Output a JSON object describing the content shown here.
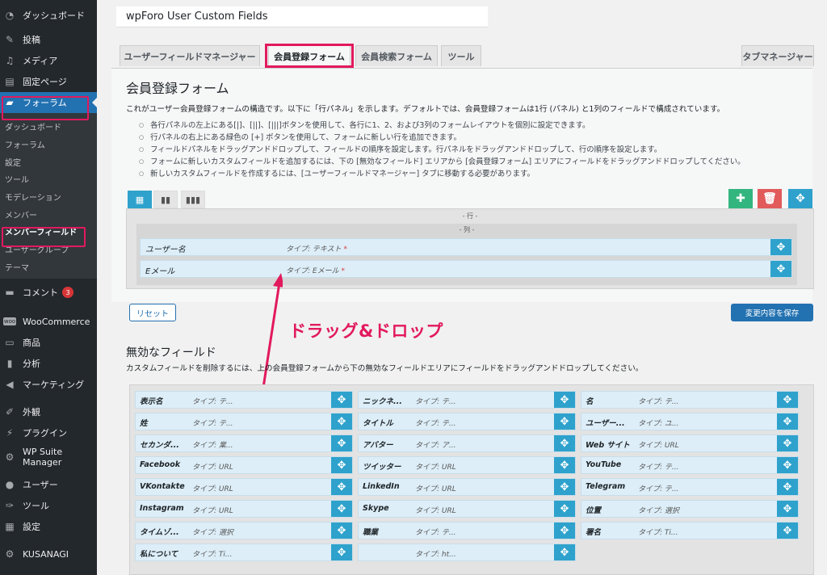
{
  "sidebar": {
    "top_items": [
      {
        "label": "ダッシュボード",
        "icon": "dashboard-icon"
      },
      {
        "label": "投稿",
        "icon": "pin-icon"
      },
      {
        "label": "メディア",
        "icon": "media-icon"
      },
      {
        "label": "固定ページ",
        "icon": "page-icon"
      }
    ],
    "forum": {
      "label": "フォーラム",
      "icon": "forum-icon"
    },
    "sub_items": [
      "ダッシュボード",
      "フォーラム",
      "設定",
      "ツール",
      "モデレーション",
      "メンバー",
      "メンバーフィールド",
      "ユーザーグループ",
      "テーマ"
    ],
    "comments": {
      "label": "コメント",
      "badge": "3"
    },
    "bottom_items": [
      {
        "label": "WooCommerce",
        "icon": "woo-icon"
      },
      {
        "label": "商品",
        "icon": "archive-icon"
      },
      {
        "label": "分析",
        "icon": "chart-icon"
      },
      {
        "label": "マーケティング",
        "icon": "megaphone-icon"
      },
      {
        "label": "外観",
        "icon": "brush-icon"
      },
      {
        "label": "プラグイン",
        "icon": "plugin-icon"
      }
    ],
    "wp_suite": {
      "line1": "WP Suite",
      "line2": "Manager"
    },
    "last_items": [
      {
        "label": "ユーザー",
        "icon": "user-icon"
      },
      {
        "label": "ツール",
        "icon": "wrench-icon"
      },
      {
        "label": "設定",
        "icon": "settings-icon"
      },
      {
        "label": "KUSANAGI",
        "icon": "gear-icon"
      }
    ]
  },
  "header": {
    "title": "wpForo User Custom Fields"
  },
  "tabs": [
    "ユーザーフィールドマネージャー",
    "会員登録フォーム",
    "会員検索フォーム",
    "ツール",
    "タブマネージャー"
  ],
  "form": {
    "title": "会員登録フォーム",
    "intro": "これがユーザー会員登録フォームの構造です。以下に「行パネル」を示します。デフォルトでは、会員登録フォームは1行 (パネル) と1列のフィールドで構成されています。",
    "bullets": [
      "各行パネルの左上にある[|]、[||]、[|||]ボタンを使用して、各行に1、2、および3列のフォームレイアウトを個別に設定できます。",
      "行パネルの右上にある緑色の [+] ボタンを使用して、フォームに新しい行を追加できます。",
      "フィールドパネルをドラッグアンドドロップして、フィールドの順序を設定します。行パネルをドラッグアンドドロップして、行の順序を設定します。",
      "フォームに新しいカスタムフィールドを追加するには、下の [無効なフィールド] エリアから [会員登録フォーム] エリアにフィールドをドラッグアンドドロップしてください。",
      "新しいカスタムフィールドを作成するには、[ユーザーフィールドマネージャー] タブに移動する必要があります。"
    ],
    "row_label": "- 行 -",
    "col_label": "- 列 -",
    "fields": [
      {
        "name": "ユーザー名",
        "type": "タイプ: テキスト",
        "req": "*"
      },
      {
        "name": "Eメール",
        "type": "タイプ: Eメール",
        "req": "*"
      }
    ],
    "reset_label": "リセット",
    "save_label": "変更内容を保存"
  },
  "annotation": "ドラッグ&ドロップ",
  "inactive": {
    "title": "無効なフィールド",
    "desc": "カスタムフィールドを削除するには、上の会員登録フォームから下の無効なフィールドエリアにフィールドをドラッグアンドドロップしてください。",
    "col1": [
      {
        "name": "表示名",
        "type": "タイプ: テ..."
      },
      {
        "name": "姓",
        "type": "タイプ: テ..."
      },
      {
        "name": "セカンダ...",
        "type": "タイプ: 業..."
      },
      {
        "name": "Facebook",
        "type": "タイプ: URL"
      },
      {
        "name": "VKontakte",
        "type": "タイプ: URL"
      },
      {
        "name": "Instagram",
        "type": "タイプ: URL"
      },
      {
        "name": "タイムゾ...",
        "type": "タイプ: 選択"
      },
      {
        "name": "私について",
        "type": "タイプ: Ti..."
      }
    ],
    "col2": [
      {
        "name": "ニックネ...",
        "type": "タイプ: テ..."
      },
      {
        "name": "タイトル",
        "type": "タイプ: テ..."
      },
      {
        "name": "アバター",
        "type": "タイプ: ア..."
      },
      {
        "name": "ツイッター",
        "type": "タイプ: URL"
      },
      {
        "name": "LinkedIn",
        "type": "タイプ: URL"
      },
      {
        "name": "Skype",
        "type": "タイプ: URL"
      },
      {
        "name": "職業",
        "type": "タイプ: テ..."
      },
      {
        "name": "",
        "type": "タイプ: ht..."
      }
    ],
    "col3": [
      {
        "name": "名",
        "type": "タイプ: テ..."
      },
      {
        "name": "ユーザー...",
        "type": "タイプ: ユ..."
      },
      {
        "name": "Web サイト",
        "type": "タイプ: URL"
      },
      {
        "name": "YouTube",
        "type": "タイプ: テ..."
      },
      {
        "name": "Telegram",
        "type": "タイプ: テ..."
      },
      {
        "name": "位置",
        "type": "タイプ: 選択"
      },
      {
        "name": "署名",
        "type": "タイプ: Ti..."
      }
    ]
  },
  "colors": {
    "accent": "#2271b1",
    "highlight": "#e2195d",
    "add": "#33b57f",
    "delete": "#e25b5b",
    "move": "#2ea2cc"
  }
}
